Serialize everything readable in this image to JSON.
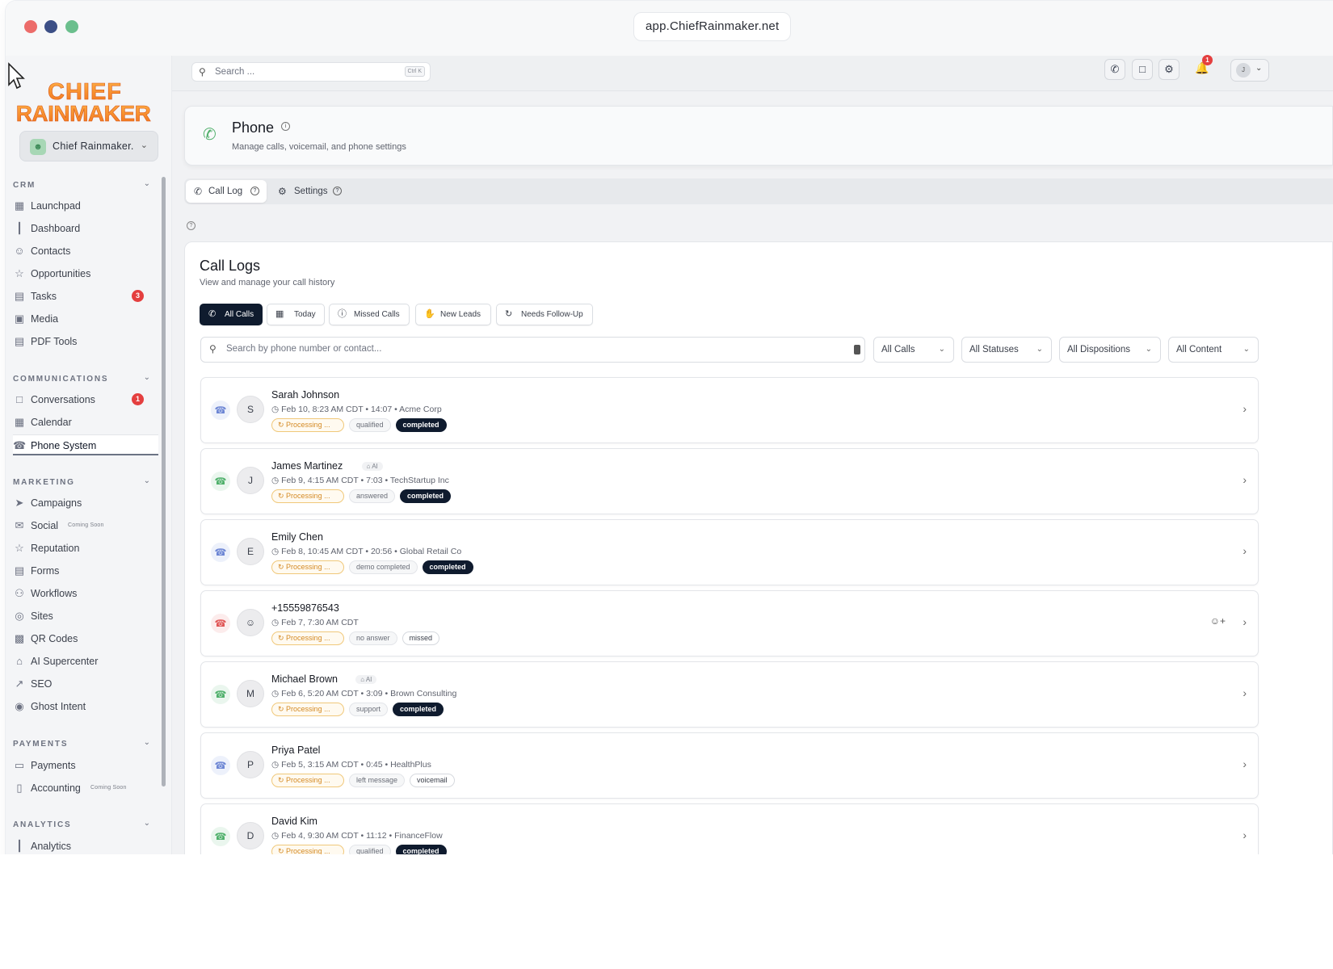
{
  "browser": {
    "url": "app.ChiefRainmaker.net"
  },
  "logo": {
    "line1": "CHIEF",
    "line2": "RAINMAKER"
  },
  "account": {
    "name": "Chief Rainmaker.",
    "avatar_icon": "users-icon"
  },
  "sidebar": {
    "sections": [
      {
        "label": "CRM",
        "items": [
          {
            "label": "Launchpad",
            "icon": "grid-icon"
          },
          {
            "label": "Dashboard",
            "icon": "bar-chart-icon"
          },
          {
            "label": "Contacts",
            "icon": "users-icon"
          },
          {
            "label": "Opportunities",
            "icon": "star-icon"
          },
          {
            "label": "Tasks",
            "icon": "document-icon",
            "badge": "3"
          },
          {
            "label": "Media",
            "icon": "image-icon"
          },
          {
            "label": "PDF Tools",
            "icon": "document-icon"
          }
        ]
      },
      {
        "label": "COMMUNICATIONS",
        "items": [
          {
            "label": "Conversations",
            "icon": "chat-icon",
            "badge": "1"
          },
          {
            "label": "Calendar",
            "icon": "calendar-icon"
          },
          {
            "label": "Phone System",
            "icon": "phone-icon",
            "active": true
          }
        ]
      },
      {
        "label": "MARKETING",
        "items": [
          {
            "label": "Campaigns",
            "icon": "send-icon"
          },
          {
            "label": "Social",
            "icon": "megaphone-icon",
            "tag": "Coming Soon"
          },
          {
            "label": "Reputation",
            "icon": "star-icon"
          },
          {
            "label": "Forms",
            "icon": "document-icon"
          },
          {
            "label": "Workflows",
            "icon": "workflow-icon"
          },
          {
            "label": "Sites",
            "icon": "globe-icon"
          },
          {
            "label": "QR Codes",
            "icon": "qr-icon"
          },
          {
            "label": "AI Supercenter",
            "icon": "robot-icon"
          },
          {
            "label": "SEO",
            "icon": "trend-icon"
          },
          {
            "label": "Ghost Intent",
            "icon": "eye-icon"
          }
        ]
      },
      {
        "label": "PAYMENTS",
        "items": [
          {
            "label": "Payments",
            "icon": "card-icon"
          },
          {
            "label": "Accounting",
            "icon": "book-icon",
            "tag": "Coming Soon"
          }
        ]
      },
      {
        "label": "ANALYTICS",
        "items": [
          {
            "label": "Analytics",
            "icon": "bar-chart-icon"
          }
        ]
      }
    ]
  },
  "topbar": {
    "search_placeholder": "Search ...",
    "shortcut": "Ctrl K",
    "notification_count": "1",
    "user_initial": "J"
  },
  "header": {
    "title": "Phone",
    "subtitle": "Manage calls, voicemail, and phone settings"
  },
  "tabs": [
    {
      "label": "Call Log",
      "active": true
    },
    {
      "label": "Settings"
    }
  ],
  "calllogs": {
    "title": "Call Logs",
    "subtitle": "View and manage your call history",
    "filters": [
      {
        "label": "All Calls",
        "active": true
      },
      {
        "label": "Today"
      },
      {
        "label": "Missed Calls"
      },
      {
        "label": "New Leads"
      },
      {
        "label": "Needs Follow-Up"
      }
    ],
    "search_placeholder": "Search by phone number or contact...",
    "selects": [
      "All Calls",
      "All Statuses",
      "All Dispositions",
      "All Content"
    ],
    "rows": [
      {
        "name": "Sarah Johnson",
        "initial": "S",
        "direction": "in",
        "ai": "",
        "meta": "Feb 10, 8:23 AM CDT • 14:07 • Acme Corp",
        "processing": "Processing ...",
        "disposition": "qualified",
        "status": "completed",
        "status_style": "done"
      },
      {
        "name": "James Martinez",
        "initial": "J",
        "direction": "out",
        "ai": "AI",
        "meta": "Feb 9, 4:15 AM CDT • 7:03 • TechStartup Inc",
        "processing": "Processing ...",
        "disposition": "answered",
        "status": "completed",
        "status_style": "done"
      },
      {
        "name": "Emily Chen",
        "initial": "E",
        "direction": "in",
        "ai": "",
        "meta": "Feb 8, 10:45 AM CDT • 20:56 • Global Retail Co",
        "processing": "Processing ...",
        "disposition": "demo completed",
        "status": "completed",
        "status_style": "done"
      },
      {
        "name": "+15559876543",
        "initial": "",
        "direction": "miss",
        "ai": "",
        "meta": "Feb 7, 7:30 AM CDT",
        "processing": "Processing ...",
        "disposition": "no answer",
        "status": "missed",
        "status_style": "plain"
      },
      {
        "name": "Michael Brown",
        "initial": "M",
        "direction": "out",
        "ai": "AI",
        "meta": "Feb 6, 5:20 AM CDT • 3:09 • Brown Consulting",
        "processing": "Processing ...",
        "disposition": "support",
        "status": "completed",
        "status_style": "done"
      },
      {
        "name": "Priya Patel",
        "initial": "P",
        "direction": "in",
        "ai": "",
        "meta": "Feb 5, 3:15 AM CDT • 0:45 • HealthPlus",
        "processing": "Processing ...",
        "disposition": "left message",
        "status": "voicemail",
        "status_style": "plain"
      },
      {
        "name": "David Kim",
        "initial": "D",
        "direction": "out",
        "ai": "",
        "meta": "Feb 4, 9:30 AM CDT • 11:12 • FinanceFlow",
        "processing": "Processing ...",
        "disposition": "qualified",
        "status": "completed",
        "status_style": "done"
      }
    ]
  }
}
